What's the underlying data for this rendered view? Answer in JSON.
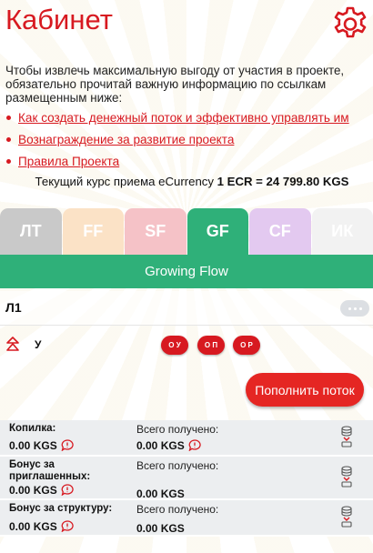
{
  "header": {
    "title": "Кабинет",
    "settings_icon": "gear-icon"
  },
  "intro": "Чтобы извлечь максимальную выгоду от участия в проекте, обязательно прочитай важную информацию по ссылкам размещенным ниже:",
  "links": [
    "Как создать денежный поток и эффективно управлять им",
    "Вознаграждение за развитие проекта",
    "Правила Проекта"
  ],
  "rate": {
    "prefix": "Текущий курс приема eCurrency",
    "value": "1 ECR = 24 799.80 KGS"
  },
  "tabs": [
    {
      "label": "ЛТ",
      "color": "#c9c9c9",
      "active": false
    },
    {
      "label": "FF",
      "color": "#fbe2c6",
      "active": false
    },
    {
      "label": "SF",
      "color": "#f5c2c7",
      "active": false
    },
    {
      "label": "GF",
      "color": "#2fb079",
      "active": true
    },
    {
      "label": "CF",
      "color": "#e3c9f0",
      "active": false
    },
    {
      "label": "ИК",
      "color": "#f2f2f2",
      "active": false
    }
  ],
  "flow_title": "Growing Flow",
  "level": {
    "label": "Л1",
    "more_icon": "more-dots-icon"
  },
  "user": {
    "letter": "У",
    "tree_icon": "tree-icon",
    "actions": [
      "О У",
      "О П",
      "О Р"
    ]
  },
  "topup_label": "Пополнить поток",
  "stats": [
    {
      "label": "Копилка:",
      "value": "0.00 KGS",
      "total_label": "Всего получено:",
      "total_value": "0.00 KGS",
      "total_has_icon": true
    },
    {
      "label": "Бонус за приглашенных:",
      "value": "0.00 KGS",
      "total_label": "Всего получено:",
      "total_value": "0.00 KGS",
      "total_has_icon": false
    },
    {
      "label": "Бонус за структуру:",
      "value": "0.00 KGS",
      "total_label": "Всего получено:",
      "total_value": "0.00 KGS",
      "total_has_icon": false
    }
  ],
  "colors": {
    "brand_red": "#d71920",
    "accent_green": "#2fb079"
  }
}
